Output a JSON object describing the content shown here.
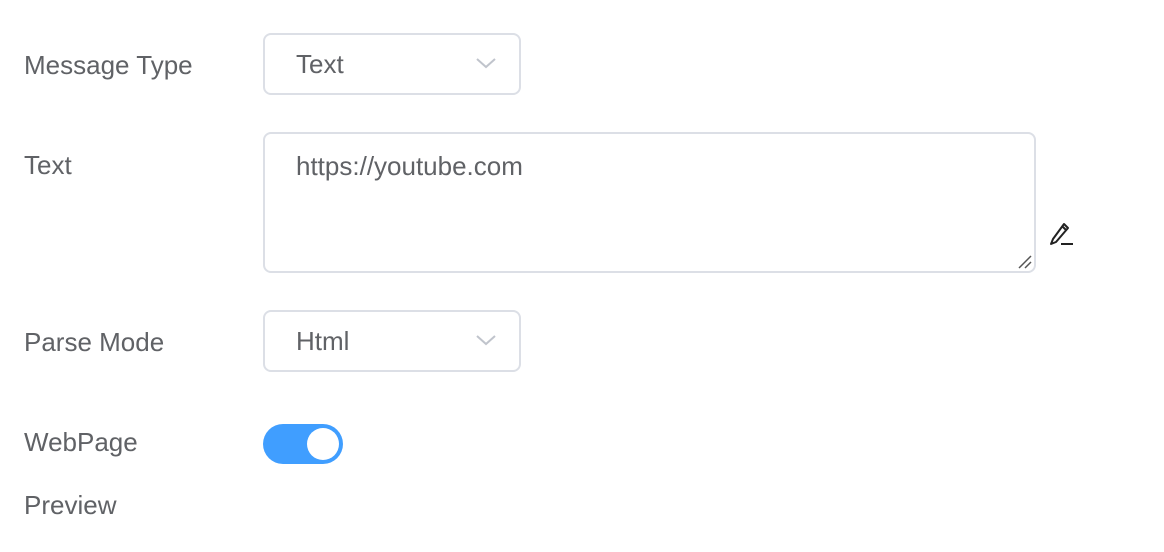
{
  "form": {
    "message_type": {
      "label": "Message Type",
      "value": "Text"
    },
    "text": {
      "label": "Text",
      "value": "https://youtube.com"
    },
    "parse_mode": {
      "label": "Parse Mode",
      "value": "Html"
    },
    "webpage_preview": {
      "label_line1": "WebPage",
      "label_line2": "Preview",
      "enabled": true
    }
  },
  "icons": {
    "dropdown": "chevron-down-icon",
    "edit": "pencil-icon",
    "resize": "resize-grip-icon"
  },
  "colors": {
    "accent": "#409eff",
    "text": "#606266",
    "border": "#dcdfe6"
  }
}
